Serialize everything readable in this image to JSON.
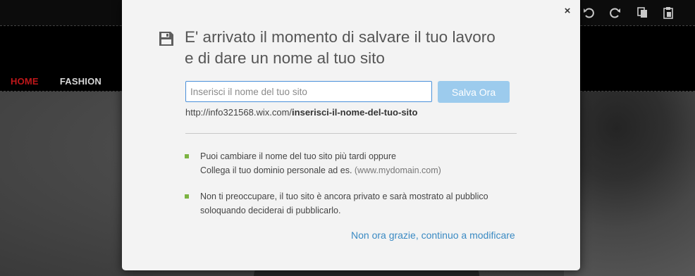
{
  "editor": {
    "nav": {
      "home": "HOME",
      "fashion": "FASHION"
    },
    "toolbar_icons": [
      "undo-icon",
      "redo-icon",
      "copy-icon",
      "paste-icon"
    ],
    "home_color": "#c0171a"
  },
  "dialog": {
    "close_label": "×",
    "title_line1": "E' arrivato il momento di salvare il tuo lavoro",
    "title_line2": "e di dare un nome al tuo sito",
    "input": {
      "value": "",
      "placeholder": "Inserisci il nome del tuo sito"
    },
    "save_button": "Salva Ora",
    "url_prefix": "http://info321568.wix.com/",
    "url_slug": "inserisci-il-nome-del-tuo-sito",
    "info1_line1": "Puoi cambiare il nome del tuo sito più tardi oppure",
    "info1_line2_a": "Collega il tuo dominio personale ad es. ",
    "info1_line2_b": "(www.mydomain.com)",
    "info2_line1": "Non ti preoccupare, il tuo sito è ancora privato e sarà mostrato al pubblico",
    "info2_line2": "soloquando deciderai di pubblicarlo.",
    "later_link": "Non ora grazie, continuo a modificare",
    "accent_color": "#3a8ac3",
    "button_color": "#9ccbed",
    "bullet_color": "#7cb342"
  }
}
